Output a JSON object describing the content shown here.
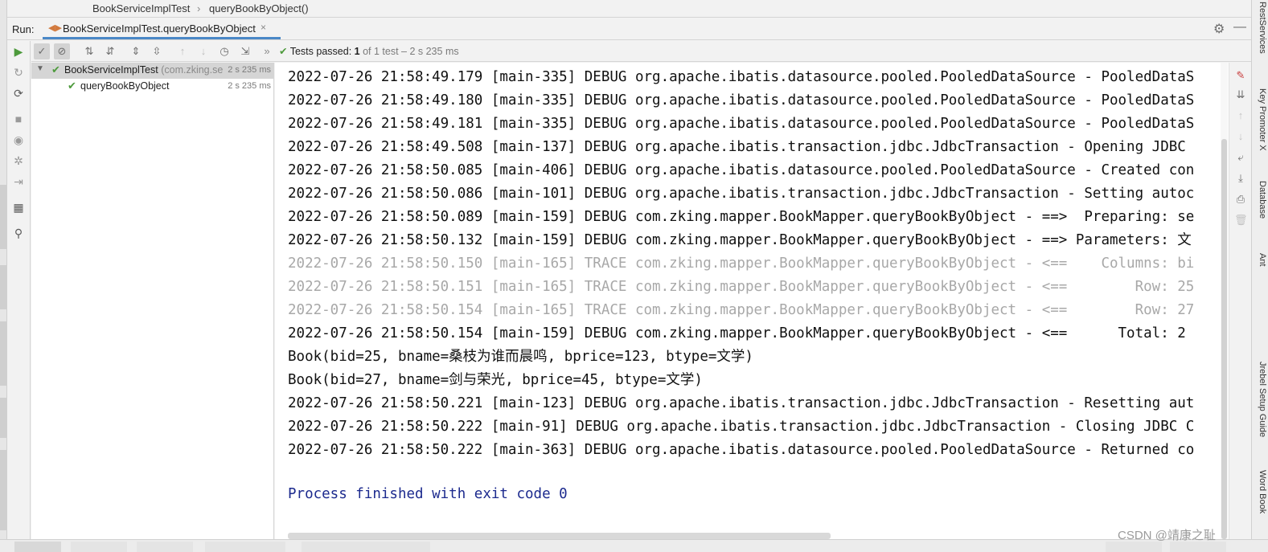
{
  "breadcrumb": {
    "items": [
      "BookServiceImplTest",
      "queryBookByObject()"
    ],
    "separator": "›"
  },
  "run_bar": {
    "label": "Run:",
    "tab_title": "BookServiceImplTest.queryBookByObject",
    "close_glyph": "×"
  },
  "test_status": {
    "passed_label": "Tests passed:",
    "passed_count": "1",
    "detail": "of 1 test – 2 s 235 ms"
  },
  "test_tree": {
    "root": {
      "name": "BookServiceImplTest",
      "package": "(com.zking.se",
      "time": "2 s 235 ms"
    },
    "child": {
      "name": "queryBookByObject",
      "time": "2 s 235 ms"
    }
  },
  "console": {
    "lines": [
      {
        "text": "2022-07-26 21:58:49.179 [main-335] DEBUG org.apache.ibatis.datasource.pooled.PooledDataSource - PooledDataS",
        "kind": "debug"
      },
      {
        "text": "2022-07-26 21:58:49.180 [main-335] DEBUG org.apache.ibatis.datasource.pooled.PooledDataSource - PooledDataS",
        "kind": "debug"
      },
      {
        "text": "2022-07-26 21:58:49.181 [main-335] DEBUG org.apache.ibatis.datasource.pooled.PooledDataSource - PooledDataS",
        "kind": "debug"
      },
      {
        "text": "2022-07-26 21:58:49.508 [main-137] DEBUG org.apache.ibatis.transaction.jdbc.JdbcTransaction - Opening JDBC",
        "kind": "debug"
      },
      {
        "text": "2022-07-26 21:58:50.085 [main-406] DEBUG org.apache.ibatis.datasource.pooled.PooledDataSource - Created con",
        "kind": "debug"
      },
      {
        "text": "2022-07-26 21:58:50.086 [main-101] DEBUG org.apache.ibatis.transaction.jdbc.JdbcTransaction - Setting autoc",
        "kind": "debug"
      },
      {
        "text": "2022-07-26 21:58:50.089 [main-159] DEBUG com.zking.mapper.BookMapper.queryBookByObject - ==>  Preparing: se",
        "kind": "debug"
      },
      {
        "text": "2022-07-26 21:58:50.132 [main-159] DEBUG com.zking.mapper.BookMapper.queryBookByObject - ==> Parameters: 文",
        "kind": "debug"
      },
      {
        "text": "2022-07-26 21:58:50.150 [main-165] TRACE com.zking.mapper.BookMapper.queryBookByObject - <==    Columns: bi",
        "kind": "trace"
      },
      {
        "text": "2022-07-26 21:58:50.151 [main-165] TRACE com.zking.mapper.BookMapper.queryBookByObject - <==        Row: 25",
        "kind": "trace"
      },
      {
        "text": "2022-07-26 21:58:50.154 [main-165] TRACE com.zking.mapper.BookMapper.queryBookByObject - <==        Row: 27",
        "kind": "trace"
      },
      {
        "text": "2022-07-26 21:58:50.154 [main-159] DEBUG com.zking.mapper.BookMapper.queryBookByObject - <==      Total: 2",
        "kind": "debug"
      },
      {
        "text": "Book(bid=25, bname=桑枝为谁而晨鸣, bprice=123, btype=文学)",
        "kind": "output"
      },
      {
        "text": "Book(bid=27, bname=剑与荣光, bprice=45, btype=文学)",
        "kind": "output"
      },
      {
        "text": "2022-07-26 21:58:50.221 [main-123] DEBUG org.apache.ibatis.transaction.jdbc.JdbcTransaction - Resetting aut",
        "kind": "debug"
      },
      {
        "text": "2022-07-26 21:58:50.222 [main-91] DEBUG org.apache.ibatis.transaction.jdbc.JdbcTransaction - Closing JDBC C",
        "kind": "debug"
      },
      {
        "text": "2022-07-26 21:58:50.222 [main-363] DEBUG org.apache.ibatis.datasource.pooled.PooledDataSource - Returned co",
        "kind": "debug"
      }
    ],
    "exit_message": "Process finished with exit code 0"
  },
  "right_strip": [
    "RestServices",
    "Key Promoter X",
    "Database",
    "Ant",
    "Jrebel Setup Guide",
    "Word Book"
  ],
  "watermark": "CSDN @靖康之耻",
  "colors": {
    "pass_green": "#4d9a3c",
    "trace_gray": "#a8a8a8",
    "exit_blue": "#1c2a8e",
    "tab_underline": "#4a88c7"
  }
}
